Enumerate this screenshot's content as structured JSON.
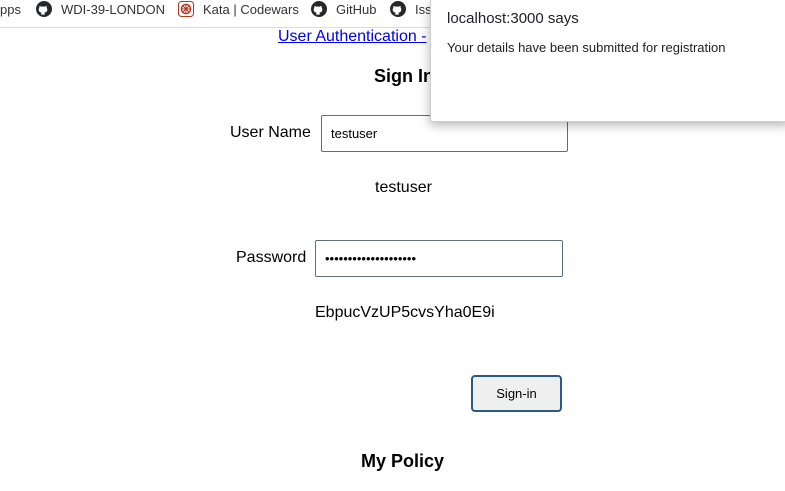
{
  "bookmarks_bar": {
    "items": [
      {
        "label": "pps",
        "icon": "apps-icon"
      },
      {
        "label": "WDI-39-LONDON",
        "icon": "github-icon"
      },
      {
        "label": "Kata | Codewars",
        "icon": "codewars-icon"
      },
      {
        "label": "GitHub",
        "icon": "github-icon"
      },
      {
        "label": "Iss",
        "icon": "github-icon"
      }
    ]
  },
  "page": {
    "nav_link": "User Authentication -",
    "sign_in_heading": "Sign In",
    "username_label": "User Name",
    "username_value": "testuser",
    "username_echo": "testuser",
    "password_label": "Password",
    "password_value": "EbpucVzUP5cvsYha0E9i",
    "password_echo": "EbpucVzUP5cvsYha0E9i",
    "sign_in_button": "Sign-in",
    "policy_heading": "My Policy"
  },
  "alert_dialog": {
    "origin": "localhost:3000 says",
    "message": "Your details have been submitted for registration"
  },
  "colors": {
    "link": "#0000ee",
    "button_border": "#2a5a86",
    "codewars_red": "#b1361e"
  }
}
